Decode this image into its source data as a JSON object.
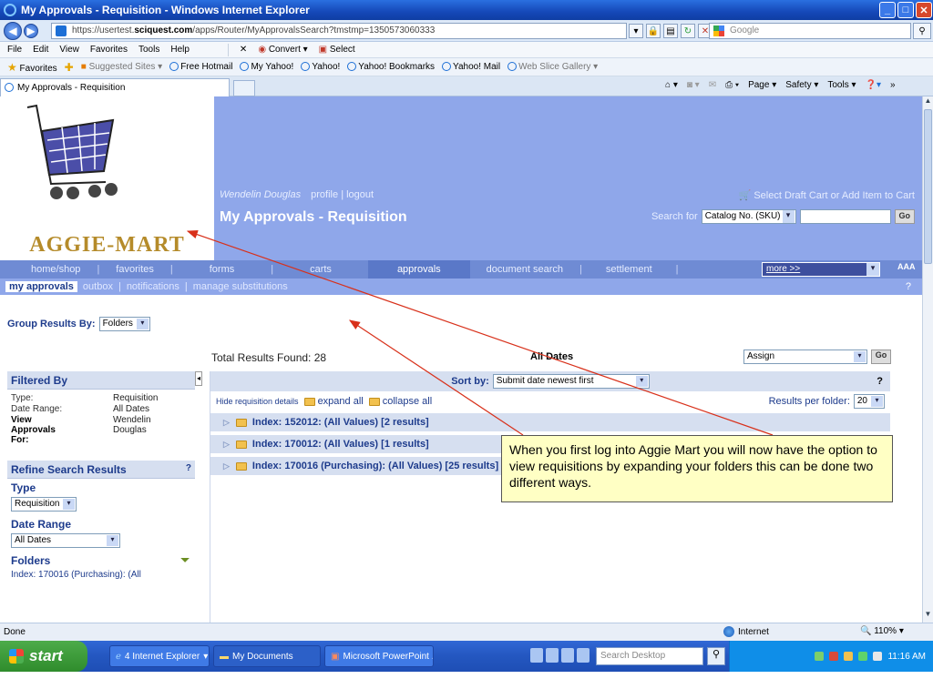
{
  "window": {
    "title": "My Approvals - Requisition - Windows Internet Explorer"
  },
  "browser": {
    "url_prefix": "https://usertest.",
    "url_host": "sciquest.com",
    "url_rest": "/apps/Router/MyApprovalsSearch?tmstmp=1350573060333",
    "search_placeholder": "Google",
    "menu": [
      "File",
      "Edit",
      "View",
      "Favorites",
      "Tools",
      "Help"
    ],
    "toolbar_convert": "Convert",
    "toolbar_select": "Select",
    "favorites_label": "Favorites",
    "favorites": [
      "Suggested Sites ▾",
      "Free Hotmail",
      "My Yahoo!",
      "Yahoo!",
      "Yahoo! Bookmarks",
      "Yahoo! Mail",
      "Web Slice Gallery ▾"
    ],
    "tab_title": "My Approvals - Requisition",
    "command_bar": [
      "Page ▾",
      "Safety ▾",
      "Tools ▾"
    ],
    "status_text": "Done",
    "zone": "Internet",
    "zoom": "110%"
  },
  "header": {
    "logo_text": "AGGIE-MART",
    "user_name": "Wendelin Douglas",
    "profile_link": "profile",
    "logout_link": "logout",
    "page_title": "My Approvals - Requisition",
    "cart_link": "Select Draft Cart or Add Item to Cart",
    "search_label": "Search for",
    "search_type": "Catalog No. (SKU)",
    "go_label": "Go"
  },
  "main_nav": {
    "items": [
      "home/shop",
      "favorites",
      "forms",
      "carts",
      "approvals",
      "document search",
      "settlement"
    ],
    "more": "more >>",
    "font_size_label": "AAA"
  },
  "sub_nav": {
    "items": [
      "my approvals",
      "outbox",
      "notifications",
      "manage substitutions"
    ],
    "help": "?"
  },
  "group": {
    "label": "Group Results By:",
    "value": "Folders"
  },
  "results_meta": {
    "total_found": "Total Results Found: 28",
    "date_filter": "All Dates",
    "action_select": "Assign",
    "go_label": "Go"
  },
  "sidebar": {
    "filtered_by_title": "Filtered By",
    "filters": [
      {
        "key": "Type:",
        "value": "Requisition"
      },
      {
        "key": "Date Range:",
        "value": "All Dates"
      },
      {
        "key": "View Approvals For:",
        "value": "Wendelin Douglas"
      }
    ],
    "refine_title": "Refine Search Results",
    "refine_help": "?",
    "type_title": "Type",
    "type_value": "Requisition",
    "date_title": "Date Range",
    "date_value": "All Dates",
    "folders_title": "Folders",
    "folder_item": "Index: 170016 (Purchasing): (All"
  },
  "results": {
    "sort_label": "Sort by:",
    "sort_value": "Submit date newest first",
    "help": "?",
    "hide_details": "Hide requisition details",
    "expand_all": "expand all",
    "collapse_all": "collapse all",
    "per_folder_label": "Results per folder:",
    "per_folder_value": "20",
    "folders": [
      "Index: 152012: (All Values) [2 results]",
      "Index: 170012: (All Values) [1 results]",
      "Index: 170016 (Purchasing): (All Values) [25 results]"
    ]
  },
  "callout": {
    "text": "When you first log into Aggie Mart you will now have the option to view requisitions by expanding your folders this can be done two different ways."
  },
  "taskbar": {
    "start": "start",
    "items": [
      "4 Internet Explorer",
      "My Documents",
      "Microsoft PowerPoint ..."
    ],
    "desktop_search": "Search Desktop",
    "clock": "11:16 AM"
  }
}
